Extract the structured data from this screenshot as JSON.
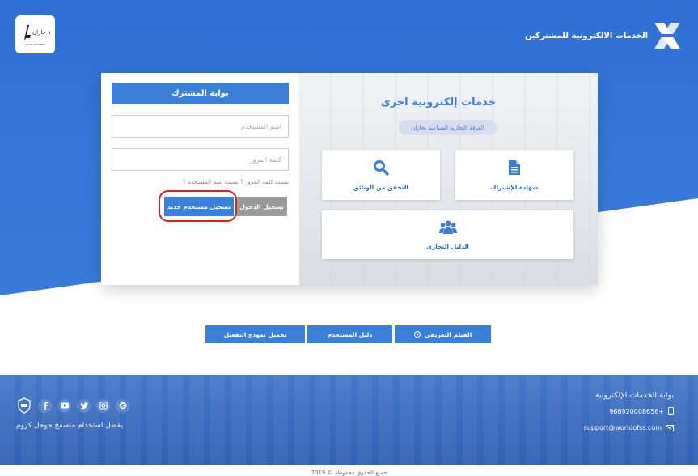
{
  "header": {
    "site_title": "الخدمات الالكترونية للمشتركين",
    "chamber_logo_text": "غرفة جازان",
    "chamber_logo_sub": "JAZAN CHAMBER"
  },
  "portal": {
    "heading": "بوابة المشترك",
    "username_placeholder": "اسم المستخدم",
    "password_placeholder": "كلمة المرور",
    "forgot_text": "نسيت كلمة المرور ؟ نسيت إسم المستخدم ؟",
    "login_label": "تسجيل الدخول",
    "register_label": "تسجيل مستخدم جديد"
  },
  "services": {
    "title": "خدمات إلكترونية اخرى",
    "subtitle": "الغرفة التجارية الصناعية بجازان",
    "tiles": [
      {
        "label": "شهادة الإشتراك",
        "icon": "document-icon"
      },
      {
        "label": "التحقق من الوثائق",
        "icon": "search-icon"
      },
      {
        "label": "الدليل التجاري",
        "icon": "users-icon"
      }
    ]
  },
  "actions": {
    "download_form": "تحميل نموذج التفعيل",
    "user_guide": "دليل المستخدم",
    "intro_film": "الفيلم التعريفي"
  },
  "footer": {
    "portal_title": "بوابة الخدمات الإلكترونية",
    "phone": "966920008656+",
    "email": "support@worldofss.com",
    "browser_hint": "يفضل استخدام متصفح جوجل كروم",
    "copyright": "جميع الحقوق محفوظة © 2019"
  },
  "colors": {
    "primary": "#3b7fd8",
    "hero": "#3174d6",
    "footer": "#3566bd",
    "highlight": "#e0201b"
  }
}
